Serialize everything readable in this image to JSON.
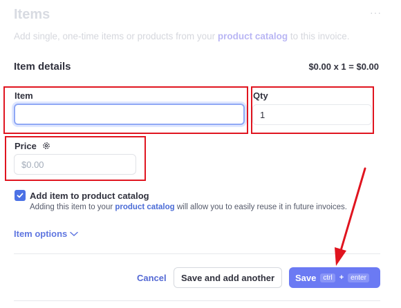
{
  "header": {
    "title": "Items",
    "more_label": "···",
    "desc_before": "Add single, one-time items or products from your",
    "desc_link": "product catalog",
    "desc_after": "to this invoice."
  },
  "item_details": {
    "title": "Item details",
    "formula": "$0.00 x 1 = $0.00"
  },
  "fields": {
    "item_label": "Item",
    "item_value": "",
    "qty_label": "Qty",
    "qty_value": "1",
    "price_label": "Price",
    "price_placeholder": "$0.00"
  },
  "catalog": {
    "checked": true,
    "label": "Add item to product catalog",
    "help_before": "Adding this item to your",
    "help_link": "product catalog",
    "help_after": "will allow you to easily reuse it in future invoices."
  },
  "item_options_label": "Item options",
  "footer": {
    "cancel_label": "Cancel",
    "save_add_label": "Save and add another",
    "save_label": "Save",
    "shortcut_key1": "ctrl",
    "shortcut_plus": "+",
    "shortcut_key2": "enter"
  },
  "colors": {
    "annotation_red": "#e0141f",
    "primary": "#6b7af3",
    "link": "#5469d4"
  },
  "icons": {
    "more": "more-horizontal-icon",
    "gear": "gear-icon",
    "check": "checkmark-icon",
    "chevron": "chevron-down-icon",
    "arrow": "annotation-arrow-icon"
  }
}
